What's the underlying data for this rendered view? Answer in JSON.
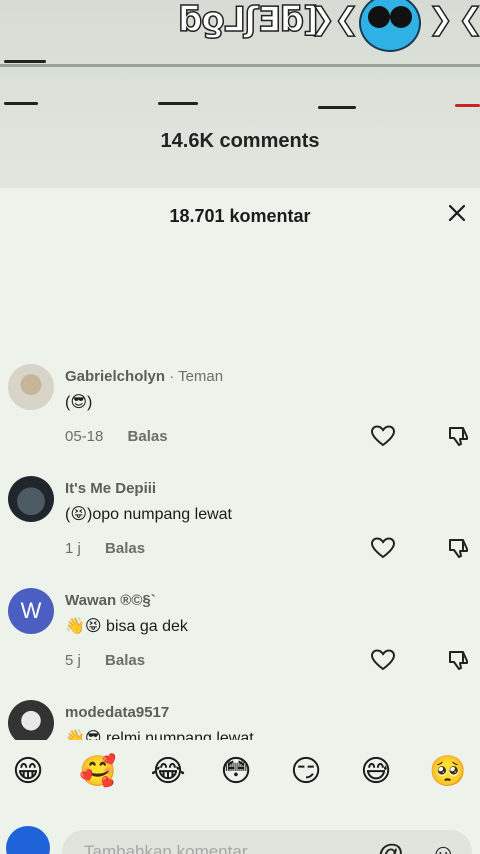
{
  "background": {
    "logo_text": "ƃƍ⅃ʃƎƃ]",
    "caption": "14.6K comments"
  },
  "sheet": {
    "title": "18.701 komentar",
    "close_icon": "close-icon"
  },
  "comments": [
    {
      "username": "Gabrielcholyn",
      "tag": "· Teman",
      "text": "(😎)",
      "date": "05-18",
      "reply_label": "Balas"
    },
    {
      "username": "It's Me Depiii",
      "tag": "",
      "text": "(😝)opo numpang lewat",
      "date": "1 j",
      "reply_label": "Balas"
    },
    {
      "username": "Wawan ®©§`",
      "tag": "",
      "text": "👋😝 bisa ga dek",
      "date": "5 j",
      "reply_label": "Balas",
      "avatar_letter": "W"
    },
    {
      "username": "modedata9517",
      "tag": "",
      "text": "👋😎 relmi numpang lewat",
      "date": "",
      "reply_label": ""
    }
  ],
  "emoji_bar": [
    "😁",
    "🥰",
    "😂",
    "😳",
    "😏",
    "😅",
    "🥺"
  ],
  "input": {
    "placeholder": "Tambahkan komentar...",
    "mention_icon": "at-icon",
    "emoji_icon": "smile-icon"
  },
  "colors": {
    "sheet_bg": "#edf3ea",
    "avatar_w": "#4a5fc1"
  }
}
